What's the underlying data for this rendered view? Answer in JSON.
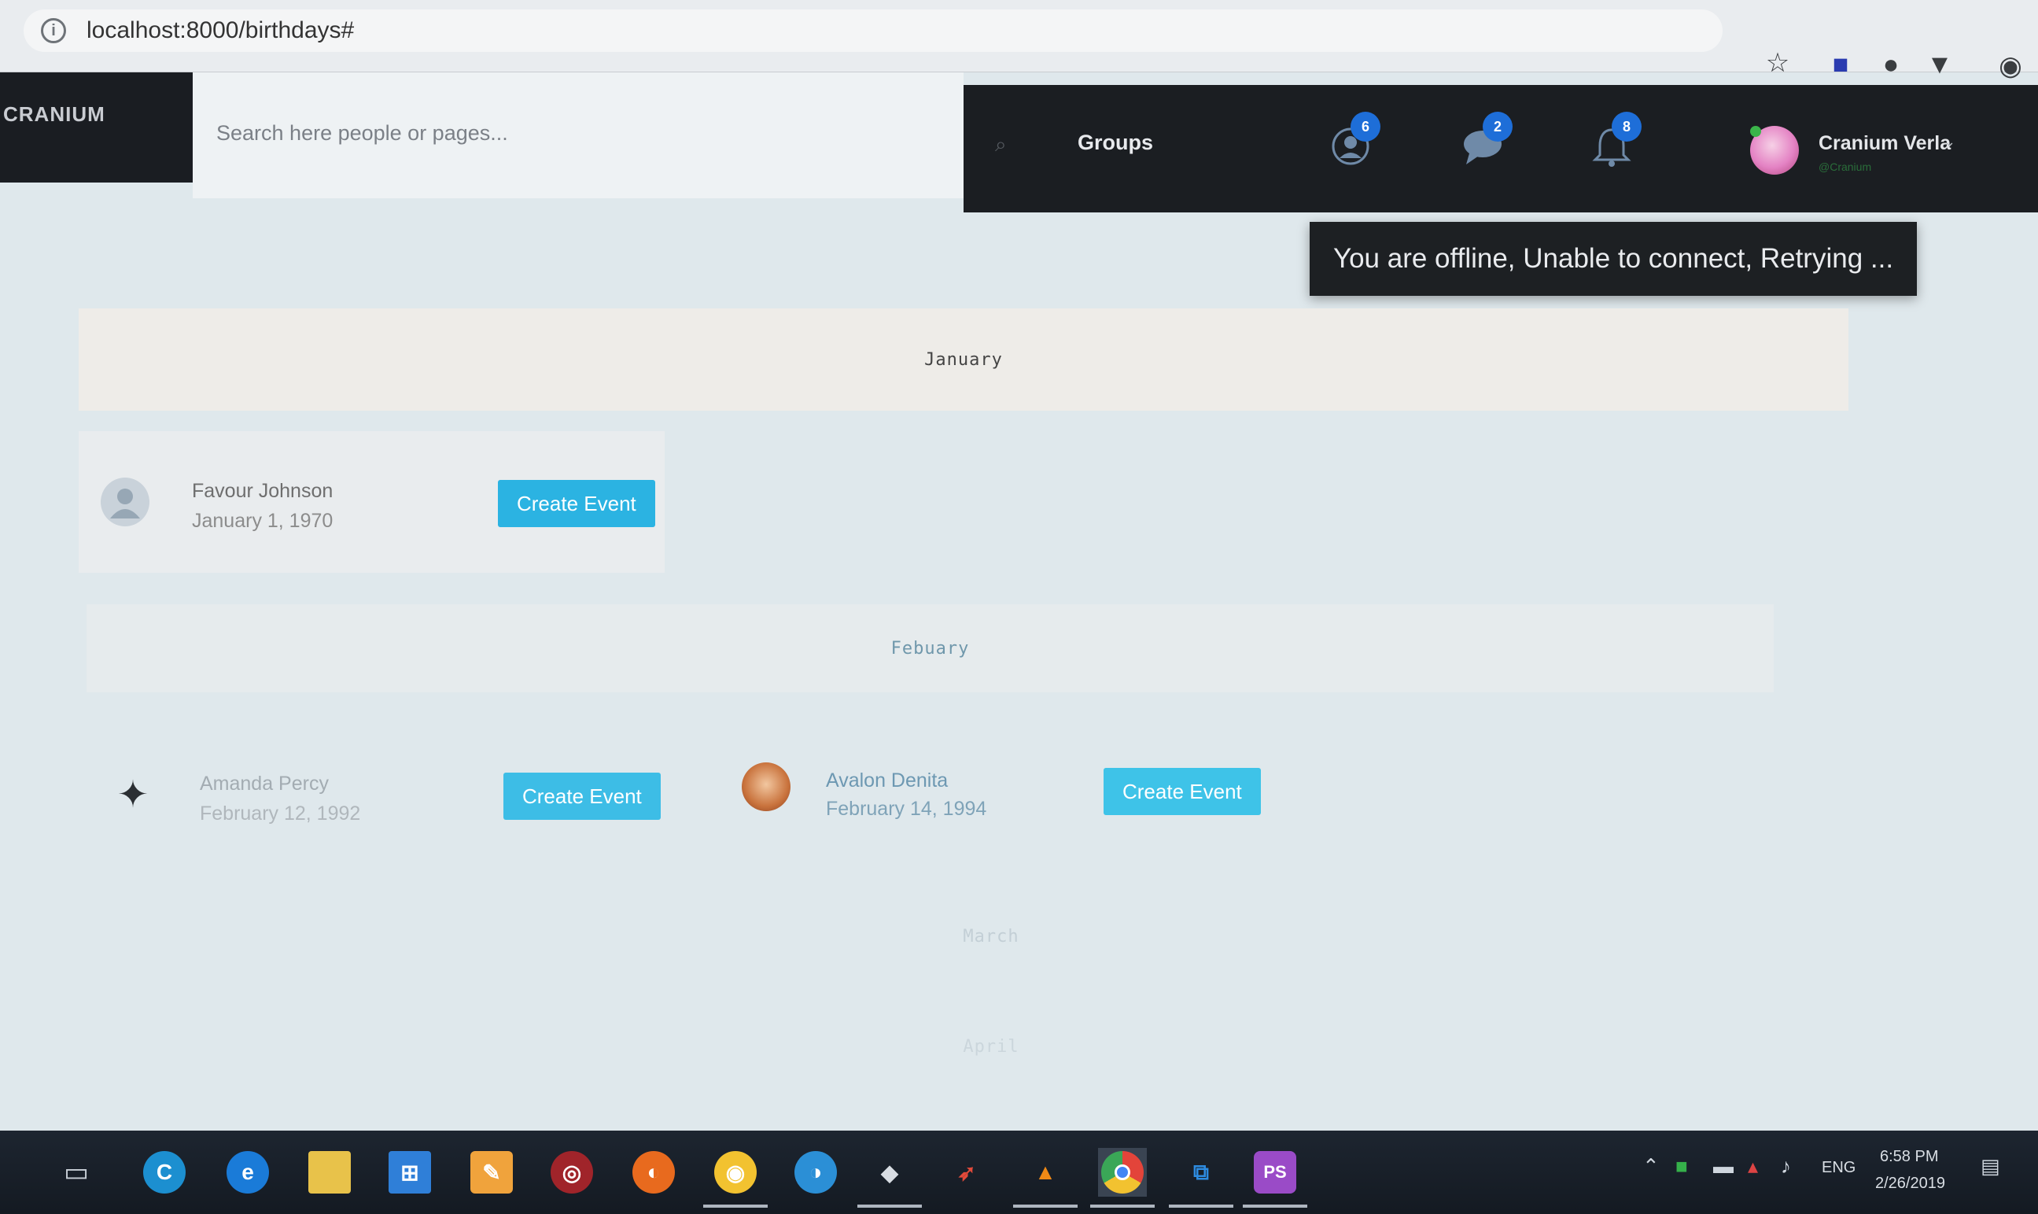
{
  "browser": {
    "url": "localhost:8000/birthdays#",
    "icons": [
      "info-icon",
      "star-icon",
      "extension-icon",
      "extension-icon",
      "extension-icon",
      "profile-icon"
    ]
  },
  "app": {
    "brand": "CRANIUM",
    "search_placeholder": "Search here people or pages...",
    "nav": {
      "groups_label": "Groups",
      "friend_requests_count": "6",
      "messages_count": "2",
      "notifications_count": "8",
      "user_name": "Cranium Verla",
      "user_handle": "@Cranium"
    },
    "toast": "You are offline, Unable to connect, Retrying ..."
  },
  "months": [
    {
      "name": "January",
      "people": [
        {
          "name": "Favour Johnson",
          "date": "January 1, 1970",
          "button": "Create Event"
        }
      ]
    },
    {
      "name": "Febuary",
      "people": [
        {
          "name": "Amanda Percy",
          "date": "February 12, 1992",
          "button": "Create Event"
        },
        {
          "name": "Avalon Denita",
          "date": "February 14, 1994",
          "button": "Create Event"
        }
      ]
    },
    {
      "name": "March",
      "people": []
    },
    {
      "name": "April",
      "people": []
    }
  ],
  "taskbar": {
    "apps": [
      "task-view-icon",
      "ccleaner-icon",
      "edge-icon",
      "file-explorer-icon",
      "store-icon",
      "paint-icon",
      "app-icon",
      "firefox-icon",
      "app-icon",
      "app-icon",
      "git-icon",
      "app-icon",
      "vlc-icon",
      "chrome-icon",
      "visual-studio-icon",
      "phpstorm-icon"
    ],
    "lang": "ENG",
    "time": "6:58 PM",
    "date": "2/26/2019"
  },
  "colors": {
    "navbar_bg": "#1b1e22",
    "button_bg": "#2bb3e2",
    "badge_bg": "#1e6ed8",
    "toast_bg": "#1d2023"
  }
}
